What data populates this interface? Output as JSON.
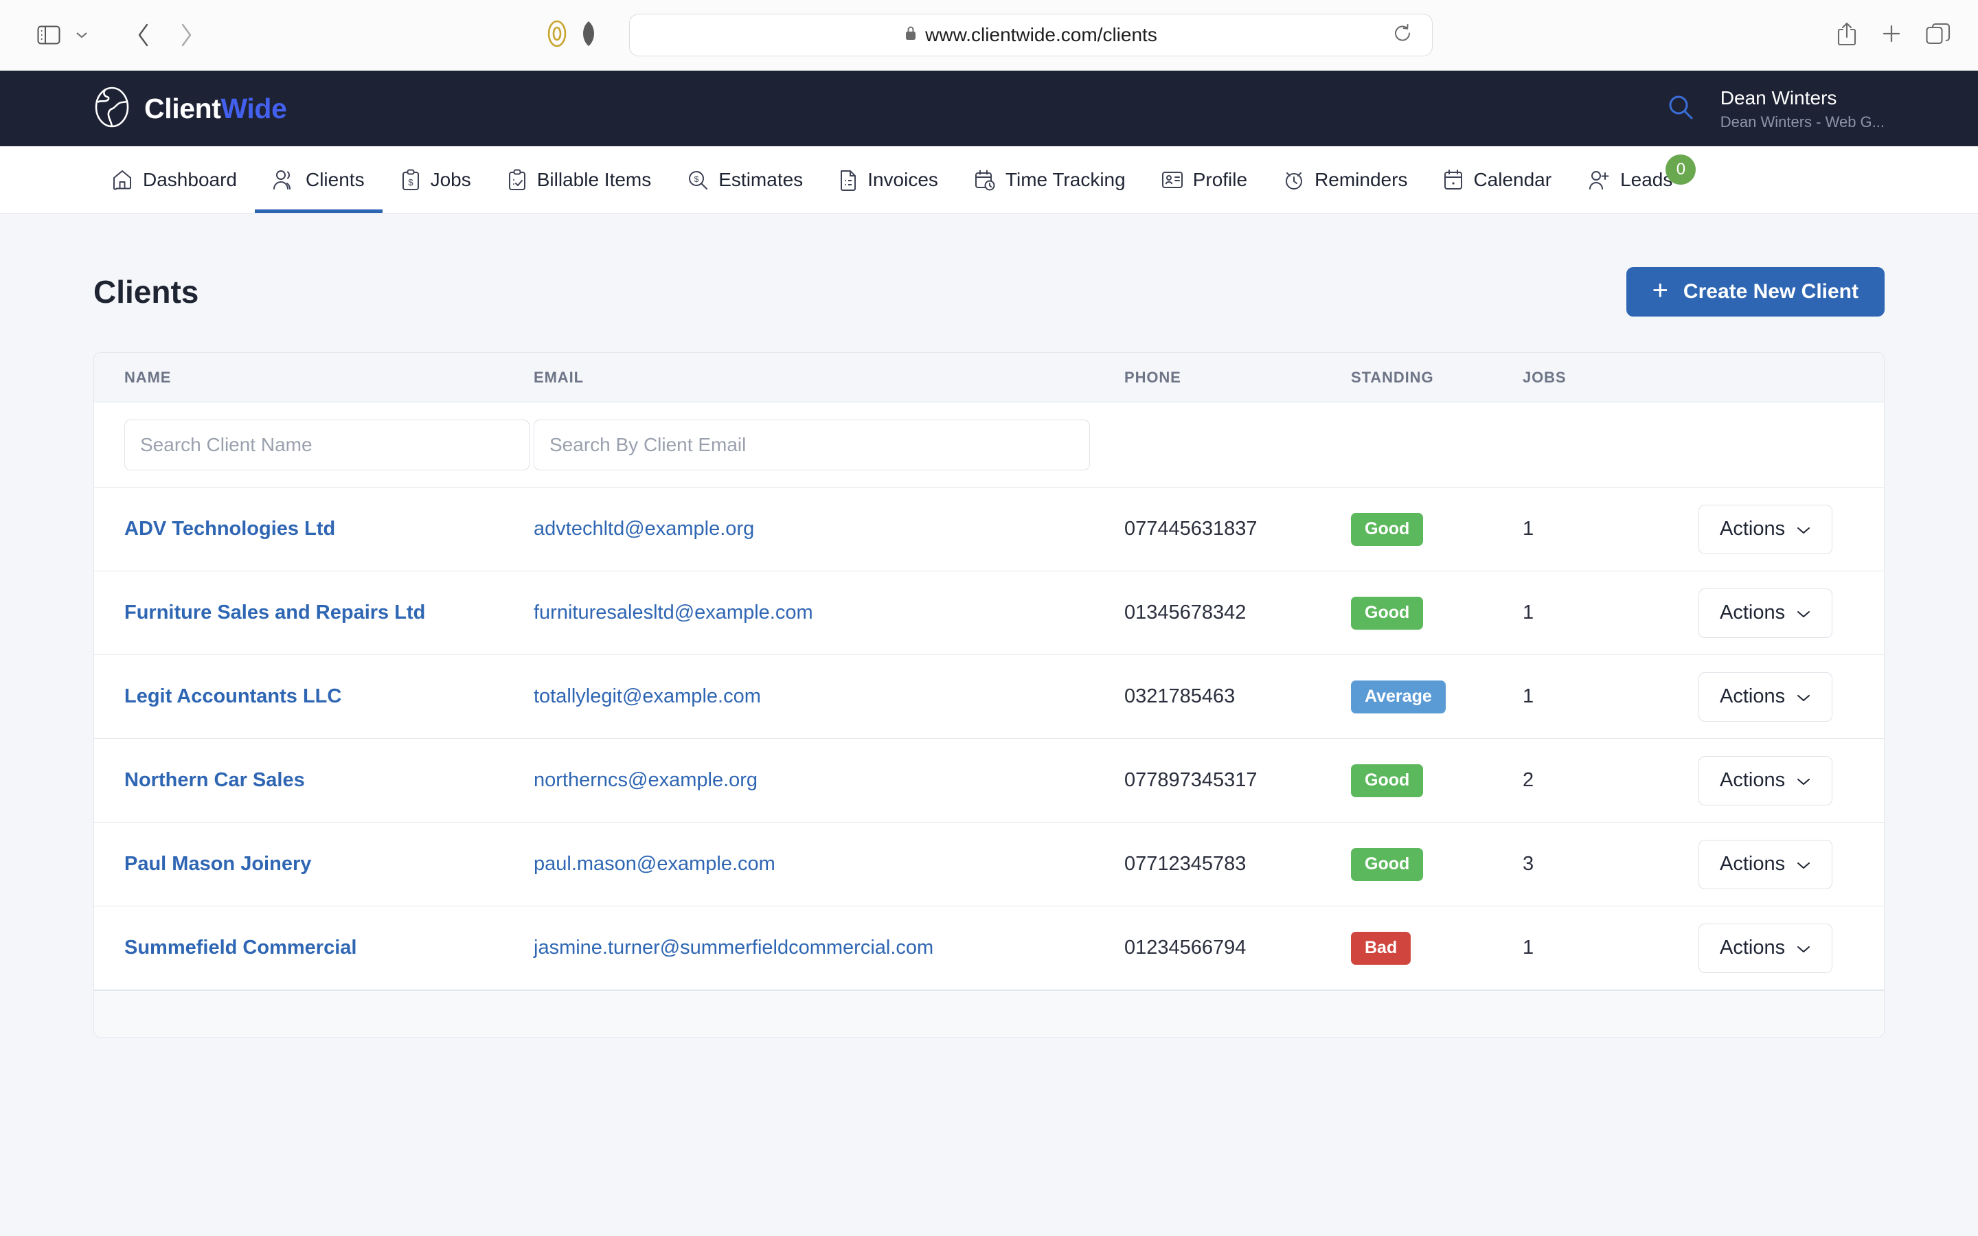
{
  "browser": {
    "url": "www.clientwide.com/clients",
    "icons": {
      "sidebar": "sidebar-toggle-icon",
      "tabgroup_chevron": "chevron-down-icon",
      "back": "back-arrow-icon",
      "forward": "forward-arrow-icon",
      "blocker": "content-blocker-icon",
      "privacy": "privacy-shield-icon",
      "lock": "lock-icon",
      "reload": "reload-icon",
      "share": "share-icon",
      "new_tab": "plus-icon",
      "tab_overview": "tab-overview-icon"
    }
  },
  "header": {
    "logo_primary": "Client",
    "logo_accent": "Wide",
    "user_name": "Dean Winters",
    "user_subtitle": "Dean Winters - Web G...",
    "search_icon": "search-icon"
  },
  "nav": {
    "items": [
      {
        "label": "Dashboard",
        "icon": "home-icon",
        "active": false
      },
      {
        "label": "Clients",
        "icon": "people-icon",
        "active": true
      },
      {
        "label": "Jobs",
        "icon": "clipboard-money-icon",
        "active": false
      },
      {
        "label": "Billable Items",
        "icon": "clipboard-check-icon",
        "active": false
      },
      {
        "label": "Estimates",
        "icon": "magnifier-money-icon",
        "active": false
      },
      {
        "label": "Invoices",
        "icon": "document-lines-icon",
        "active": false
      },
      {
        "label": "Time Tracking",
        "icon": "calendar-clock-icon",
        "active": false
      },
      {
        "label": "Profile",
        "icon": "id-card-icon",
        "active": false
      },
      {
        "label": "Reminders",
        "icon": "alarm-clock-icon",
        "active": false
      },
      {
        "label": "Calendar",
        "icon": "calendar-icon",
        "active": false
      },
      {
        "label": "Leads",
        "icon": "user-plus-icon",
        "active": false,
        "badge": "0"
      }
    ]
  },
  "page": {
    "title": "Clients",
    "create_button": "Create New Client",
    "create_icon": "plus-icon"
  },
  "table": {
    "columns": [
      "NAME",
      "EMAIL",
      "PHONE",
      "STANDING",
      "JOBS"
    ],
    "filters": {
      "name_placeholder": "Search Client Name",
      "name_value": "",
      "email_placeholder": "Search By Client Email",
      "email_value": ""
    },
    "actions_label": "Actions",
    "actions_icon": "chevron-down-icon",
    "rows": [
      {
        "name": "ADV Technologies Ltd",
        "email": "advtechltd@example.org",
        "phone": "077445631837",
        "standing": "Good",
        "standing_type": "good",
        "jobs": "1"
      },
      {
        "name": "Furniture Sales and Repairs Ltd",
        "email": "furnituresalesltd@example.com",
        "phone": "01345678342",
        "standing": "Good",
        "standing_type": "good",
        "jobs": "1"
      },
      {
        "name": "Legit Accountants LLC",
        "email": "totallylegit@example.com",
        "phone": "0321785463",
        "standing": "Average",
        "standing_type": "average",
        "jobs": "1"
      },
      {
        "name": "Northern Car Sales",
        "email": "northerncs@example.org",
        "phone": "077897345317",
        "standing": "Good",
        "standing_type": "good",
        "jobs": "2"
      },
      {
        "name": "Paul Mason Joinery",
        "email": "paul.mason@example.com",
        "phone": "07712345783",
        "standing": "Good",
        "standing_type": "good",
        "jobs": "3"
      },
      {
        "name": "Summefield Commercial",
        "email": "jasmine.turner@summerfieldcommercial.com",
        "phone": "01234566794",
        "standing": "Bad",
        "standing_type": "bad",
        "jobs": "1"
      }
    ]
  },
  "colors": {
    "header_bg": "#1e2235",
    "accent_blue": "#2f66b3",
    "logo_accent": "#4361ee",
    "badge_good": "#5cb85c",
    "badge_average": "#5b9bd5",
    "badge_bad": "#d1453f",
    "leads_badge": "#6aa84f",
    "page_bg": "#f4f6f9"
  }
}
